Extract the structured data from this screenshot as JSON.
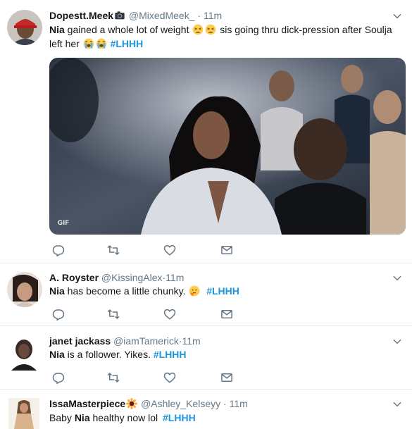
{
  "tweets": [
    {
      "display_name": "Dopestt.Meek",
      "handle": "@MixedMeek_",
      "dot": "·",
      "time": "11m",
      "text_bold": "Nia",
      "text_part1": " gained a whole lot of weight ",
      "text_part2": " sis going thru dick-pression after Soulja left her ",
      "hashtag": "#LHHH",
      "media_badge": "GIF"
    },
    {
      "display_name": "A. Royster",
      "handle": "@KissingAlex",
      "dot": "·",
      "time": "11m",
      "text_bold": "Nia",
      "text_part1": " has become a little chunky. ",
      "hashtag": "#LHHH"
    },
    {
      "display_name": "janet jackass",
      "handle": "@iamTamerick",
      "dot": "·",
      "time": "11m",
      "text_bold": "Nia",
      "text_part1": " is a follower. Yikes. ",
      "hashtag": "#LHHH"
    },
    {
      "display_name": "IssaMasterpiece",
      "handle": "@Ashley_Kelseyy",
      "dot": "·",
      "time": "11m",
      "text_prefix": "Baby ",
      "text_bold": "Nia",
      "text_part1": " healthy now lol ",
      "hashtag": "#LHHH"
    }
  ],
  "icons": {
    "reply": "reply-icon",
    "retweet": "retweet-icon",
    "like": "heart-icon",
    "dm": "envelope-icon",
    "caret": "chevron-down-icon",
    "camera": "camera-icon",
    "emoji_tired": "tired-face-emoji",
    "emoji_crying": "loudly-crying-emoji",
    "emoji_thinking": "thinking-face-emoji",
    "emoji_sunflower": "sunflower-emoji"
  },
  "colors": {
    "hashtag": "#1b95e0",
    "secondary_text": "#657786",
    "border": "#e6ecf0",
    "icon": "#657786"
  }
}
